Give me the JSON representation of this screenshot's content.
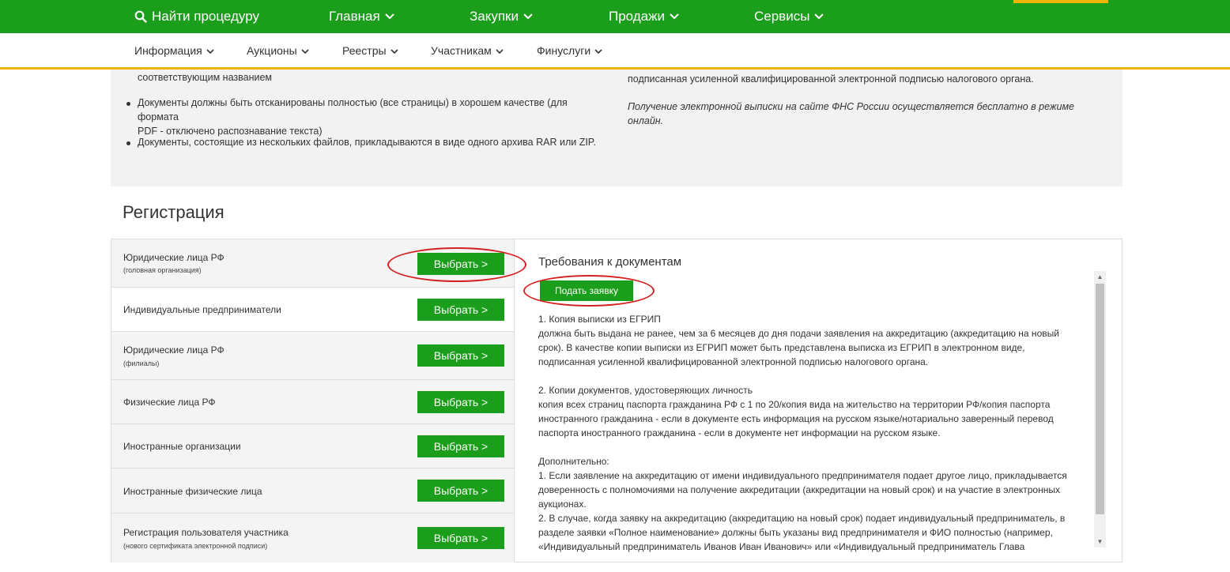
{
  "topnav": {
    "search_label": "Найти процедуру",
    "items": [
      "Главная",
      "Закупки",
      "Продажи",
      "Сервисы"
    ]
  },
  "subnav": {
    "items": [
      "Информация",
      "Аукционы",
      "Реестры",
      "Участникам",
      "Финуслуги"
    ]
  },
  "info": {
    "left_partial": "соответствующим названием",
    "bullet1_line1": "Документы должны быть отсканированы полностью (все страницы) в хорошем качестве (для формата",
    "bullet1_line2": "PDF - отключено распознавание текста)",
    "bullet2": "Документы, состоящие из нескольких файлов, прикладываются в виде одного архива RAR или ZIP.",
    "right_partial": "подписанная усиленной квалифицированной электронной подписью налогового органа.",
    "right_italic": "Получение электронной выписки на сайте ФНС России осуществляется бесплатно в режиме онлайн."
  },
  "registration": {
    "title": "Регистрация",
    "button_label": "Выбрать >",
    "rows": [
      {
        "label": "Юридические лица РФ",
        "sub": "(головная организация)"
      },
      {
        "label": "Индивидуальные предприниматели",
        "sub": ""
      },
      {
        "label": "Юридические лица РФ",
        "sub": "(филиалы)"
      },
      {
        "label": "Физические лица РФ",
        "sub": ""
      },
      {
        "label": "Иностранные организации",
        "sub": ""
      },
      {
        "label": "Иностранные физические лица",
        "sub": ""
      },
      {
        "label": "Регистрация пользователя участника",
        "sub": "(нового сертификата электронной подписи)"
      }
    ]
  },
  "requirements": {
    "title": "Требования к документам",
    "apply_label": "Подать заявку",
    "p1_head": "1. Копия выписки из ЕГРИП",
    "p1_l1": "должна быть выдана не ранее, чем за 6 месяцев до дня подачи заявления на аккредитацию (аккредитацию на новый",
    "p1_l2": "срок). В качестве копии выписки из ЕГРИП может быть представлена выписка из ЕГРИП в электронном виде,",
    "p1_l3": "подписанная усиленной квалифицированной электронной подписью налогового органа.",
    "p2_head": "2. Копии документов, удостоверяющих личность",
    "p2_l1": "копия всех страниц паспорта гражданина РФ с 1 по 20/копия вида на жительство на территории РФ/копия паспорта",
    "p2_l2": "иностранного гражданина - если в документе есть информация на русском языке/нотариально заверенный перевод",
    "p2_l3": "паспорта иностранного гражданина - если в документе нет информации на русском языке.",
    "p3_head": "Дополнительно:",
    "p3_l1": "1. Если заявление на аккредитацию от имени индивидуального предпринимателя подает другое лицо, прикладывается",
    "p3_l2": "доверенность с полномочиями на получение аккредитации (аккредитации на новый срок) и на участие в электронных",
    "p3_l3": "аукционах.",
    "p3_l4": "2. В случае, когда заявку на аккредитацию (аккредитацию на новый срок) подает индивидуальный предприниматель, в",
    "p3_l5": "разделе заявки «Полное наименование» должны быть указаны вид предпринимателя и ФИО полностью (например,",
    "p3_l6": "«Индивидуальный предприниматель Иванов Иван Иванович» или «Индивидуальный предприниматель Глава"
  },
  "colors": {
    "brand_green": "#1b9e1b",
    "accent_yellow": "#f0b400",
    "annotation_red": "#d32020"
  }
}
